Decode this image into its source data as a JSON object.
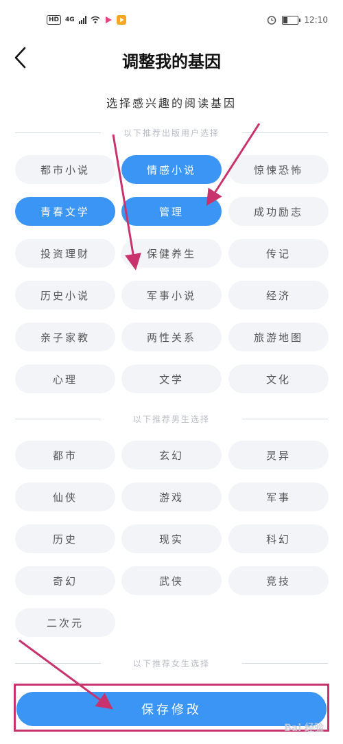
{
  "status_bar": {
    "hd": "HD",
    "network": "4G",
    "time": "12:10",
    "icons": [
      "signal-icon",
      "wifi-icon",
      "video-app-icon",
      "play-app-icon",
      "alarm-icon",
      "battery-icon"
    ]
  },
  "header": {
    "title": "调整我的基因",
    "back_icon": "back-arrow-icon"
  },
  "subtitle": "选择感兴趣的阅读基因",
  "sections": {
    "publishing": {
      "label": "以下推荐出版用户选择",
      "tags": [
        {
          "label": "都市小说",
          "selected": false
        },
        {
          "label": "情感小说",
          "selected": true
        },
        {
          "label": "惊悚恐怖",
          "selected": false
        },
        {
          "label": "青春文学",
          "selected": true
        },
        {
          "label": "管理",
          "selected": true
        },
        {
          "label": "成功励志",
          "selected": false
        },
        {
          "label": "投资理财",
          "selected": false
        },
        {
          "label": "保健养生",
          "selected": false
        },
        {
          "label": "传记",
          "selected": false
        },
        {
          "label": "历史小说",
          "selected": false
        },
        {
          "label": "军事小说",
          "selected": false
        },
        {
          "label": "经济",
          "selected": false
        },
        {
          "label": "亲子家教",
          "selected": false
        },
        {
          "label": "两性关系",
          "selected": false
        },
        {
          "label": "旅游地图",
          "selected": false
        },
        {
          "label": "心理",
          "selected": false
        },
        {
          "label": "文学",
          "selected": false
        },
        {
          "label": "文化",
          "selected": false
        }
      ]
    },
    "male": {
      "label": "以下推荐男生选择",
      "tags": [
        {
          "label": "都市",
          "selected": false
        },
        {
          "label": "玄幻",
          "selected": false
        },
        {
          "label": "灵异",
          "selected": false
        },
        {
          "label": "仙侠",
          "selected": false
        },
        {
          "label": "游戏",
          "selected": false
        },
        {
          "label": "军事",
          "selected": false
        },
        {
          "label": "历史",
          "selected": false
        },
        {
          "label": "现实",
          "selected": false
        },
        {
          "label": "科幻",
          "selected": false
        },
        {
          "label": "奇幻",
          "selected": false
        },
        {
          "label": "武侠",
          "selected": false
        },
        {
          "label": "竞技",
          "selected": false
        },
        {
          "label": "二次元",
          "selected": false
        }
      ]
    },
    "female": {
      "label": "以下推荐女生选择"
    }
  },
  "save_button": "保存修改",
  "watermark": "Bai 经验",
  "colors": {
    "accent": "#3b95f5",
    "tag_bg": "#f2f4f7",
    "annotation": "#c8336e"
  }
}
